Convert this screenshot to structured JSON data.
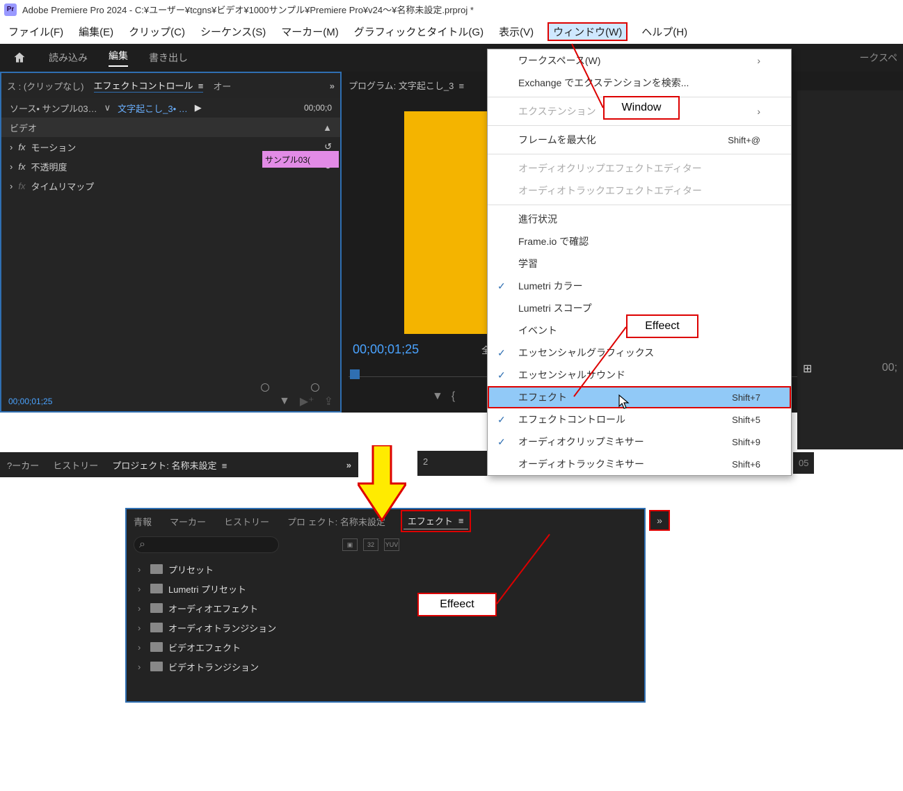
{
  "title": "Adobe Premiere Pro 2024 - C:¥ユーザー¥tcgns¥ビデオ¥1000サンプル¥Premiere Pro¥v24～¥名称未設定.prproj *",
  "menubar": {
    "file": "ファイル(F)",
    "edit": "編集(E)",
    "clip": "クリップ(C)",
    "seq": "シーケンス(S)",
    "marker": "マーカー(M)",
    "graphics": "グラフィックとタイトル(G)",
    "view": "表示(V)",
    "window": "ウィンドウ(W)",
    "help": "ヘルプ(H)"
  },
  "topTabs": {
    "import": "読み込み",
    "edit": "編集",
    "export": "書き出し"
  },
  "sourcePanel": {
    "noClip": "ス :  (クリップなし)",
    "effectCtrl": "エフェクトコントロール",
    "audio": "オー",
    "srcName": "ソース• サンプル03…",
    "seqName": "文字起こし_3• …",
    "timecodeTop": "00;00;0",
    "clipLabel": "サンプル03(",
    "video": "ビデオ",
    "motion": "モーション",
    "opacity": "不透明度",
    "timeremap": "タイムリマップ",
    "tcFoot": "00;00;01;25"
  },
  "program": {
    "label": "プログラム: 文字起こし_3",
    "tc": "00;00;01;25",
    "full": "全",
    "tcRight": "00;"
  },
  "dropdown": {
    "workspace": "ワークスペース(W)",
    "exchange": "Exchange でエクステンションを検索...",
    "extension": "エクステンション",
    "maximize": "フレームを最大化",
    "maximizeSc": "Shift+@",
    "audioClipFx": "オーディオクリップエフェクトエディター",
    "audioTrackFx": "オーディオトラックエフェクトエディター",
    "progress": "進行状況",
    "frameio": "Frame.io で確認",
    "learn": "学習",
    "lumetriColor": "Lumetri カラー",
    "lumetriScope": "Lumetri スコープ",
    "event": "イベント",
    "essGraphics": "エッセンシャルグラフィックス",
    "essSound": "エッセンシャルサウンド",
    "effects": "エフェクト",
    "effectsSc": "Shift+7",
    "effectCtrl": "エフェクトコントロール",
    "effectCtrlSc": "Shift+5",
    "audioClipMixer": "オーディオクリップミキサー",
    "audioClipMixerSc": "Shift+9",
    "audioTrackMixer": "オーディオトラックミキサー",
    "audioTrackMixerSc": "Shift+6"
  },
  "bottomTabs": {
    "marker": "?ーカー",
    "history": "ヒストリー",
    "project": "プロジェクト: 名称未設定"
  },
  "timeline": {
    "num": "2",
    "rt": "05"
  },
  "callouts": {
    "window": "Window",
    "effect1": "Effeect",
    "effect2": "Effeect"
  },
  "effectsPanel": {
    "info": "青報",
    "marker": "マーカー",
    "history": "ヒストリー",
    "project": "プロ      ェクト: 名称未設定",
    "effects": "エフェクト",
    "searchPlaceholder": "",
    "folders": [
      "プリセット",
      "Lumetri プリセット",
      "オーディオエフェクト",
      "オーディオトランジション",
      "ビデオエフェクト",
      "ビデオトランジション"
    ]
  },
  "rightTabTrunc": "ークスペ"
}
